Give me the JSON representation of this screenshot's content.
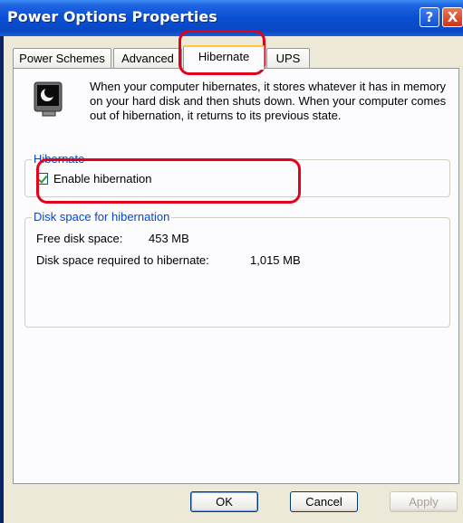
{
  "window": {
    "title": "Power Options Properties",
    "help_button": "?",
    "close_button": "X"
  },
  "tabs": [
    {
      "label": "Power Schemes"
    },
    {
      "label": "Advanced"
    },
    {
      "label": "Hibernate"
    },
    {
      "label": "UPS"
    }
  ],
  "active_tab": "Hibernate",
  "hibernate": {
    "intro_text": "When your computer hibernates, it stores whatever it has in memory on your hard disk and then shuts down. When your computer comes out of hibernation, it returns to its previous state.",
    "group_label": "Hibernate",
    "enable_label": "Enable hibernation",
    "enable_checked": true
  },
  "disk_space": {
    "group_label": "Disk space for hibernation",
    "free_label": "Free disk space:",
    "free_value": "453 MB",
    "required_label": "Disk space required to hibernate:",
    "required_value": "1,015 MB"
  },
  "buttons": {
    "ok": "OK",
    "cancel": "Cancel",
    "apply": "Apply"
  },
  "colors": {
    "title_bar": "#0a4fd4",
    "annotation": "#e3001b",
    "group_legend": "#0046d5"
  }
}
